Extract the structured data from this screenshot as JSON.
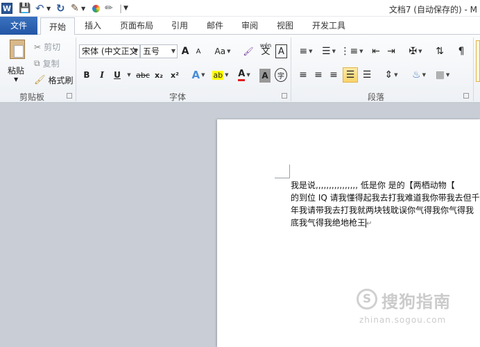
{
  "window": {
    "title": "文档7 (自动保存的) - M"
  },
  "quick_access": {
    "app_icon": "word-logo-icon",
    "logo_letter": "W",
    "save_icon": "save-icon",
    "undo_icon": "undo-icon",
    "redo_icon": "redo-icon",
    "format_painter_icon": "brush-icon",
    "color_icon": "color-wheel-icon",
    "draw_icon": "pen-icon",
    "customize_icon": "customize-dropdown-icon"
  },
  "tabs": [
    {
      "label": "文件"
    },
    {
      "label": "开始"
    },
    {
      "label": "插入"
    },
    {
      "label": "页面布局"
    },
    {
      "label": "引用"
    },
    {
      "label": "邮件"
    },
    {
      "label": "审阅"
    },
    {
      "label": "视图"
    },
    {
      "label": "开发工具"
    }
  ],
  "clipboard": {
    "paste_label": "粘贴",
    "cut_label": "剪切",
    "copy_label": "复制",
    "format_painter_label": "格式刷",
    "group_label": "剪贴板"
  },
  "font": {
    "font_name": "宋体 (中文正文",
    "font_size": "五号",
    "grow_label": "A",
    "shrink_label": "A",
    "case_label": "Aa",
    "phonetic_label": "wén",
    "phonetic_char": "文",
    "border_char": "A",
    "bold_label": "B",
    "italic_label": "I",
    "underline_label": "U",
    "strike_label": "abc",
    "subscript_label": "x₂",
    "superscript_label": "x²",
    "effects_label": "A",
    "highlight_label": "ab",
    "font_color_label": "A",
    "shading_label": "A",
    "enclose_label": "字",
    "group_label": "字体"
  },
  "paragraph": {
    "group_label": "段落"
  },
  "colors": {
    "file_tab": "#2b5797",
    "highlight": "#ffff00",
    "font_color": "#e11c1c",
    "selected_button": "#f8d36b"
  },
  "document": {
    "lines": [
      "我是说,,,,,,,,,,,,,,,, 低是你  是的【两栖动物【",
      "的到位 IQ 请我懂得起我去打我难道我你带我去但千",
      "年我请带我去打我就两块钱耽误你气得我你气得我",
      "底我气得我绝地枪王"
    ],
    "paragraph_mark": "↵"
  },
  "watermark": {
    "logo_char": "S",
    "text": "搜狗指南",
    "url": "zhinan.sogou.com"
  }
}
